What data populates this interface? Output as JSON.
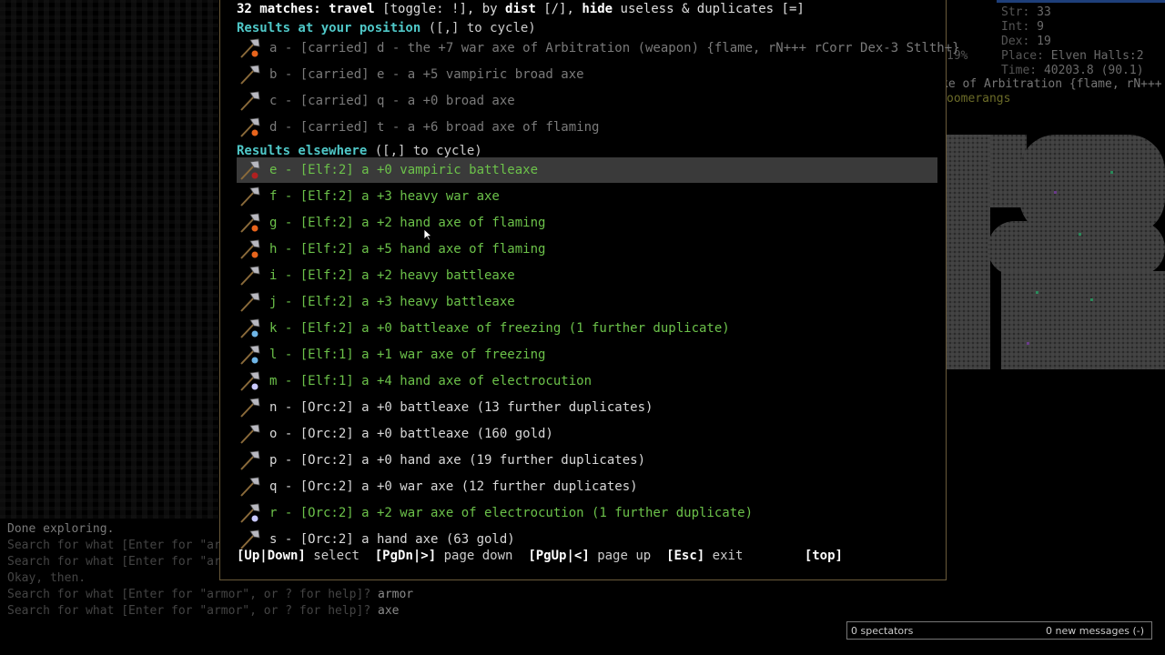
{
  "stats": {
    "str_label": "Str:",
    "str_value": "33",
    "int_label": "Int:",
    "int_value": "9",
    "dex_label": "Dex:",
    "dex_value": "19",
    "place_label": "Place:",
    "place_value": "Elven Halls:2",
    "time_label": "Time:",
    "time_value": "40203.8 (90.1)",
    "percent": "19%",
    "weapon_line": "ke of Arbitration {flame, rN+++",
    "quiver_line": "oomerangs"
  },
  "popup": {
    "title_count": "32 matches:",
    "title_rest_1": "travel",
    "title_rest_2": "[toggle: !], by",
    "title_rest_3": "dist",
    "title_rest_4": "[/],",
    "title_rest_5": "hide",
    "title_rest_6": "useless & duplicates [=]",
    "section_here_head": "Results at your position",
    "section_here_tail": "([,] to cycle)",
    "section_else_head": "Results elsewhere",
    "section_else_tail": "([,] to cycle)",
    "items": [
      {
        "text": "a - [carried] d - the +7 war axe of Arbitration (weapon) {flame, rN+++ rCorr Dex-3 Stlth+}",
        "style": "grey",
        "icon": "war-axe-flaming-icon"
      },
      {
        "text": "b - [carried] e - a +5 vampiric broad axe",
        "style": "grey",
        "icon": "broad-axe-icon"
      },
      {
        "text": "c - [carried] q - a +0 broad axe",
        "style": "grey",
        "icon": "broad-axe-plain-icon"
      },
      {
        "text": "d - [carried] t - a +6 broad axe of flaming",
        "style": "grey",
        "icon": "broad-axe-flaming-icon"
      },
      {
        "text": "e - [Elf:2] a +0 vampiric battleaxe",
        "style": "green",
        "icon": "battleaxe-vampiric-icon"
      },
      {
        "text": "f - [Elf:2] a +3 heavy war axe",
        "style": "green",
        "icon": "war-axe-icon"
      },
      {
        "text": "g - [Elf:2] a +2 hand axe of flaming",
        "style": "green",
        "icon": "hand-axe-flaming-icon"
      },
      {
        "text": "h - [Elf:2] a +5 hand axe of flaming",
        "style": "green",
        "icon": "hand-axe-flaming-icon"
      },
      {
        "text": "i - [Elf:2] a +2 heavy battleaxe",
        "style": "green",
        "icon": "battleaxe-icon"
      },
      {
        "text": "j - [Elf:2] a +3 heavy battleaxe",
        "style": "green",
        "icon": "battleaxe-icon"
      },
      {
        "text": "k - [Elf:2] a +0 battleaxe of freezing (1 further duplicate)",
        "style": "green",
        "icon": "battleaxe-freezing-icon"
      },
      {
        "text": "l - [Elf:1] a +1 war axe of freezing",
        "style": "green",
        "icon": "war-axe-freezing-icon"
      },
      {
        "text": "m - [Elf:1] a +4 hand axe of electrocution",
        "style": "green",
        "icon": "hand-axe-electric-icon"
      },
      {
        "text": "n - [Orc:2] a +0 battleaxe (13 further duplicates)",
        "style": "white",
        "icon": "battleaxe-plain-icon"
      },
      {
        "text": "o - [Orc:2] a +0 battleaxe (160 gold)",
        "style": "white",
        "icon": "battleaxe-plain-icon"
      },
      {
        "text": "p - [Orc:2] a +0 hand axe (19 further duplicates)",
        "style": "white",
        "icon": "hand-axe-plain-icon"
      },
      {
        "text": "q - [Orc:2] a +0 war axe (12 further duplicates)",
        "style": "white",
        "icon": "war-axe-plain-icon"
      },
      {
        "text": "r - [Orc:2] a +2 war axe of electrocution (1 further duplicate)",
        "style": "green",
        "icon": "war-axe-electric-icon"
      },
      {
        "text": "s - [Orc:2] a hand axe (63 gold)",
        "style": "white",
        "icon": "hand-axe-plain-icon"
      }
    ],
    "footer": {
      "k1": "[Up|Down]",
      "l1": "select",
      "k2": "[PgDn|>]",
      "l2": "page down",
      "k3": "[PgUp|<]",
      "l3": "page up",
      "k4": "[Esc]",
      "l4": "exit",
      "k5": "[top]"
    }
  },
  "messages": [
    {
      "text": "Done exploring.",
      "bright": true
    },
    {
      "text": "Search for what [Enter for \"ar",
      "bright": false
    },
    {
      "text": "Search for what [Enter for \"ar",
      "bright": false
    },
    {
      "text": "Okay, then.",
      "bright": false
    },
    {
      "text": "Search for what [Enter for \"armor\", or ? for help]?",
      "answer": "armor",
      "bright": false
    },
    {
      "text": "Search for what [Enter for \"armor\", or ? for help]?",
      "answer": "axe",
      "bright": false
    }
  ],
  "spectators": {
    "left": "0 spectators",
    "right": "0 new messages (-)"
  },
  "colors": {
    "section_heading": "#4fc7c7",
    "item_green": "#6cc24a",
    "item_grey": "#7a7a7a",
    "item_white": "#d8d8d8",
    "selected_row": "#3a3a3a",
    "popup_border": "#6a5a3a"
  }
}
